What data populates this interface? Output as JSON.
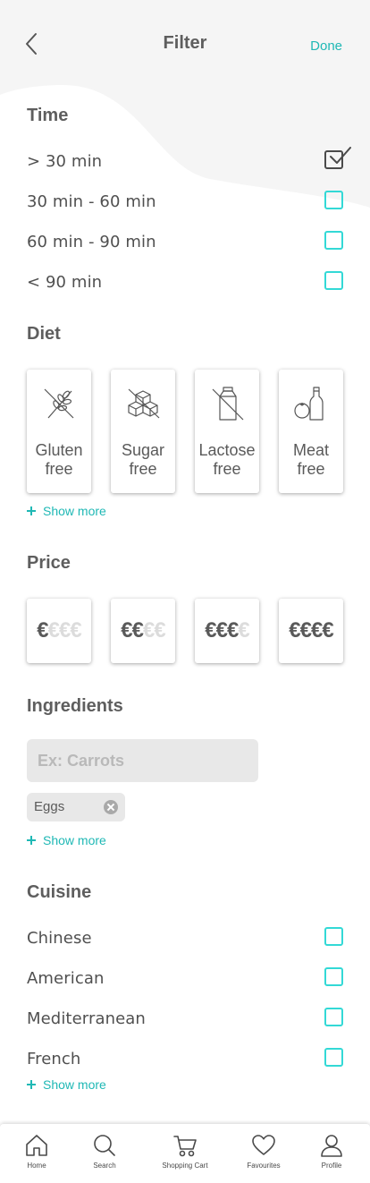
{
  "header": {
    "title": "Filter",
    "done_label": "Done"
  },
  "time": {
    "title": "Time",
    "options": [
      {
        "label": "> 30 min",
        "checked": true
      },
      {
        "label": "30 min - 60 min",
        "checked": false
      },
      {
        "label": "60 min - 90 min",
        "checked": false
      },
      {
        "label": "< 90 min",
        "checked": false
      }
    ]
  },
  "diet": {
    "title": "Diet",
    "cards": [
      {
        "line1": "Gluten",
        "line2": "free",
        "icon": "no-wheat-icon"
      },
      {
        "line1": "Sugar",
        "line2": "free",
        "icon": "no-sugar-cubes-icon"
      },
      {
        "line1": "Lactose",
        "line2": "free",
        "icon": "no-milk-icon"
      },
      {
        "line1": "Meat",
        "line2": "free",
        "icon": "vegetables-bottle-icon"
      }
    ],
    "show_more": "Show more"
  },
  "price": {
    "title": "Price",
    "levels": [
      {
        "active": "€",
        "inactive": "€€€"
      },
      {
        "active": "€€",
        "inactive": "€€"
      },
      {
        "active": "€€€",
        "inactive": "€"
      },
      {
        "active": "€€€€",
        "inactive": ""
      }
    ]
  },
  "ingredients": {
    "title": "Ingredients",
    "placeholder": "Ex: Carrots",
    "chips": [
      "Eggs"
    ],
    "show_more": "Show more"
  },
  "cuisine": {
    "title": "Cuisine",
    "options": [
      {
        "label": "Chinese",
        "checked": false
      },
      {
        "label": "American",
        "checked": false
      },
      {
        "label": "Mediterranean",
        "checked": false
      },
      {
        "label": "French",
        "checked": false
      }
    ],
    "show_more": "Show more"
  },
  "tabbar": {
    "items": [
      {
        "label": "Home",
        "icon": "home-icon"
      },
      {
        "label": "Search",
        "icon": "search-icon"
      },
      {
        "label": "Shopping Cart",
        "icon": "cart-icon"
      },
      {
        "label": "Favourites",
        "icon": "heart-icon"
      },
      {
        "label": "Profile",
        "icon": "profile-icon"
      }
    ]
  },
  "colors": {
    "accent": "#1fb8b5",
    "checkbox": "#33d9d6",
    "wave": "#f5f5f5",
    "text": "#5e5e5e"
  }
}
